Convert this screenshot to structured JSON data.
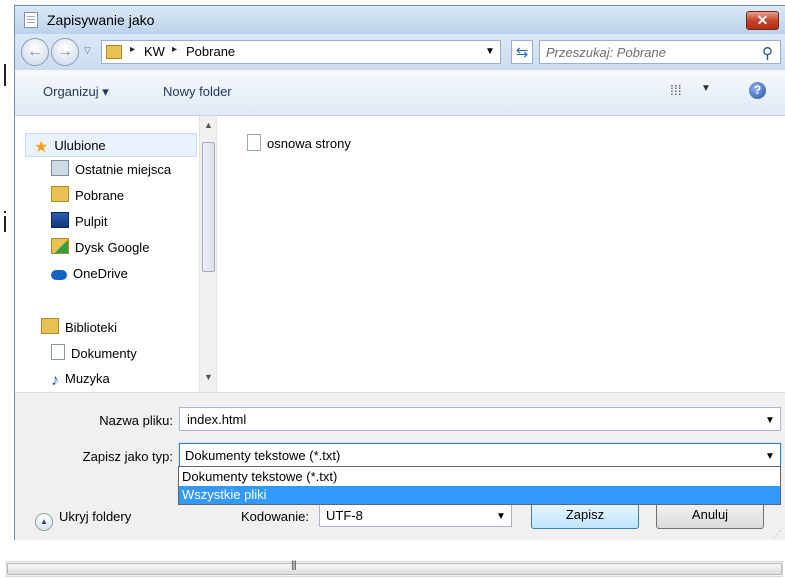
{
  "window": {
    "title": "Zapisywanie jako",
    "close_glyph": "✕"
  },
  "address": {
    "path": [
      "KW",
      "Pobrane"
    ],
    "sep": "▸"
  },
  "search": {
    "placeholder": "Przeszukaj: Pobrane"
  },
  "toolbar": {
    "organize_label": "Organizuj ▾",
    "new_folder_label": "Nowy folder"
  },
  "nav": {
    "favorites": "Ulubione",
    "items": [
      "Ostatnie miejsca",
      "Pobrane",
      "Pulpit",
      "Dysk Google",
      "OneDrive"
    ],
    "libraries": "Biblioteki",
    "library_items": [
      "Dokumenty",
      "Muzyka"
    ]
  },
  "files": [
    {
      "name": "osnowa strony"
    }
  ],
  "form": {
    "file_name_label": "Nazwa pliku:",
    "file_name_value": "index.html",
    "type_label": "Zapisz jako typ:",
    "type_value": "Dokumenty tekstowe (*.txt)",
    "type_options": [
      "Dokumenty tekstowe (*.txt)",
      "Wszystkie pliki"
    ],
    "encoding_label": "Kodowanie:",
    "encoding_value": "UTF-8",
    "save_label": "Zapisz",
    "cancel_label": "Anuluj",
    "hide_folders_label": "Ukryj foldery"
  },
  "colors": {
    "selection": "#3399ff",
    "titlebar": "#bcd3ec",
    "close": "#c6452d"
  }
}
